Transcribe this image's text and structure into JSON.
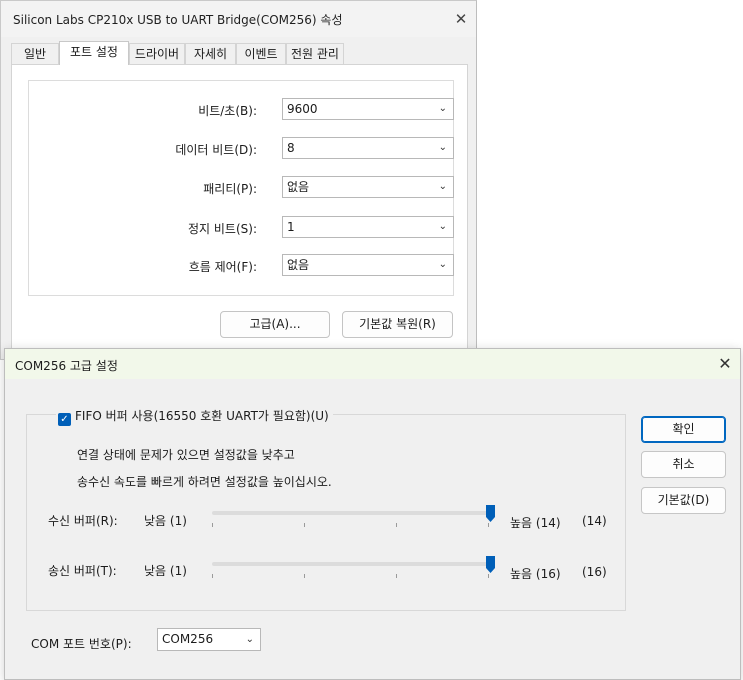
{
  "props_window": {
    "title": "Silicon Labs CP210x USB to UART Bridge(COM256) 속성",
    "close_glyph": "✕",
    "tabs": [
      {
        "label": "일반"
      },
      {
        "label": "포트 설정"
      },
      {
        "label": "드라이버"
      },
      {
        "label": "자세히"
      },
      {
        "label": "이벤트"
      },
      {
        "label": "전원 관리"
      }
    ],
    "settings": [
      {
        "label": "비트/초(B):",
        "value": "9600"
      },
      {
        "label": "데이터 비트(D):",
        "value": "8"
      },
      {
        "label": "패리티(P):",
        "value": "없음"
      },
      {
        "label": "정지 비트(S):",
        "value": "1"
      },
      {
        "label": "흐름 제어(F):",
        "value": "없음"
      }
    ],
    "advanced_button": "고급(A)...",
    "restore_defaults_button": "기본값 복원(R)"
  },
  "advanced_dialog": {
    "title": "COM256 고급 설정",
    "close_glyph": "✕",
    "fifo_checkbox": {
      "label": "FIFO 버퍼 사용(16550 호환 UART가 필요함)(U)",
      "checked": true
    },
    "desc_line1": "연결 상태에 문제가 있으면 설정값을 낮추고",
    "desc_line2": "송수신 속도를 빠르게 하려면 설정값을 높이십시오.",
    "receive_buffer": {
      "label": "수신 버퍼(R):",
      "min_label": "낮음 (1)",
      "max_label": "높음 (14)",
      "current": "(14)",
      "value": 14,
      "min": 1,
      "max": 14
    },
    "transmit_buffer": {
      "label": "송신 버퍼(T):",
      "min_label": "낮음 (1)",
      "max_label": "높음 (16)",
      "current": "(16)",
      "value": 16,
      "min": 1,
      "max": 16
    },
    "com_port_label": "COM 포트 번호(P):",
    "com_port_value": "COM256",
    "ok_button": "확인",
    "cancel_button": "취소",
    "defaults_button": "기본값(D)"
  },
  "colors": {
    "accent": "#005fb8",
    "title_tint": "#f2f8ea"
  }
}
